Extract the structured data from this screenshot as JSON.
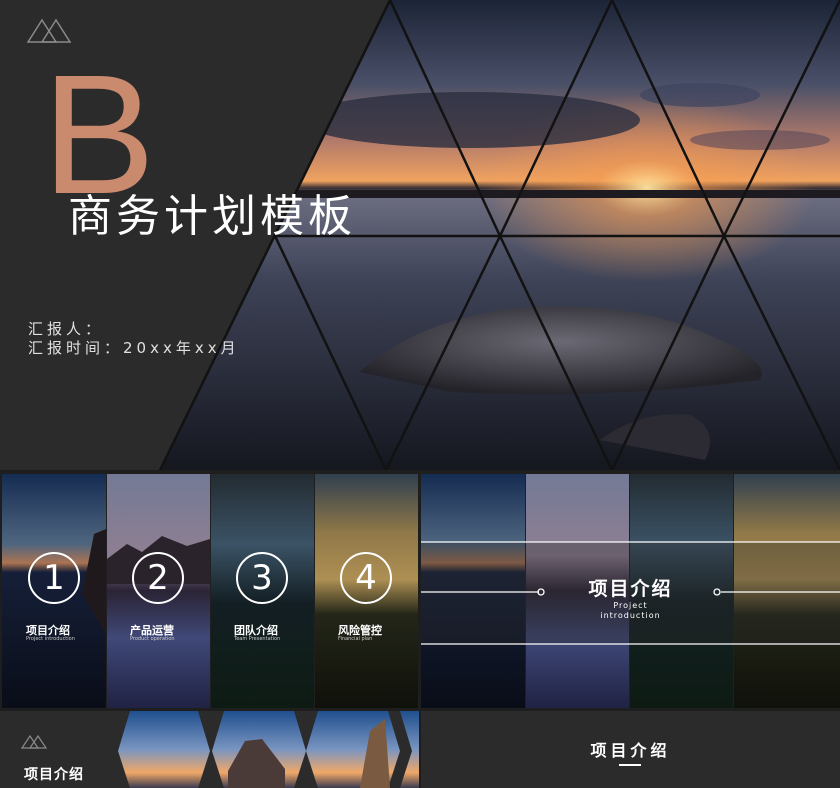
{
  "cover": {
    "big_letter": "B",
    "title": "商务计划模板",
    "reporter_label": "汇报人：",
    "time_label": "汇报时间：20xx年xx月",
    "accent": "#c98a6e",
    "logo_icon": "double-triangle-icon"
  },
  "toc": {
    "items": [
      {
        "num": "1",
        "title": "项目介绍",
        "sub": "Project introduction"
      },
      {
        "num": "2",
        "title": "产品运营",
        "sub": "Product operation"
      },
      {
        "num": "3",
        "title": "团队介绍",
        "sub": "Team Presentation"
      },
      {
        "num": "4",
        "title": "风险管控",
        "sub": "Financial plan"
      }
    ]
  },
  "project": {
    "title": "项目介绍",
    "sub1": "Project",
    "sub2": "introduction"
  },
  "section4": {
    "title": "项目介绍",
    "logo_icon": "double-triangle-icon"
  },
  "section5": {
    "title": "项目介绍"
  }
}
